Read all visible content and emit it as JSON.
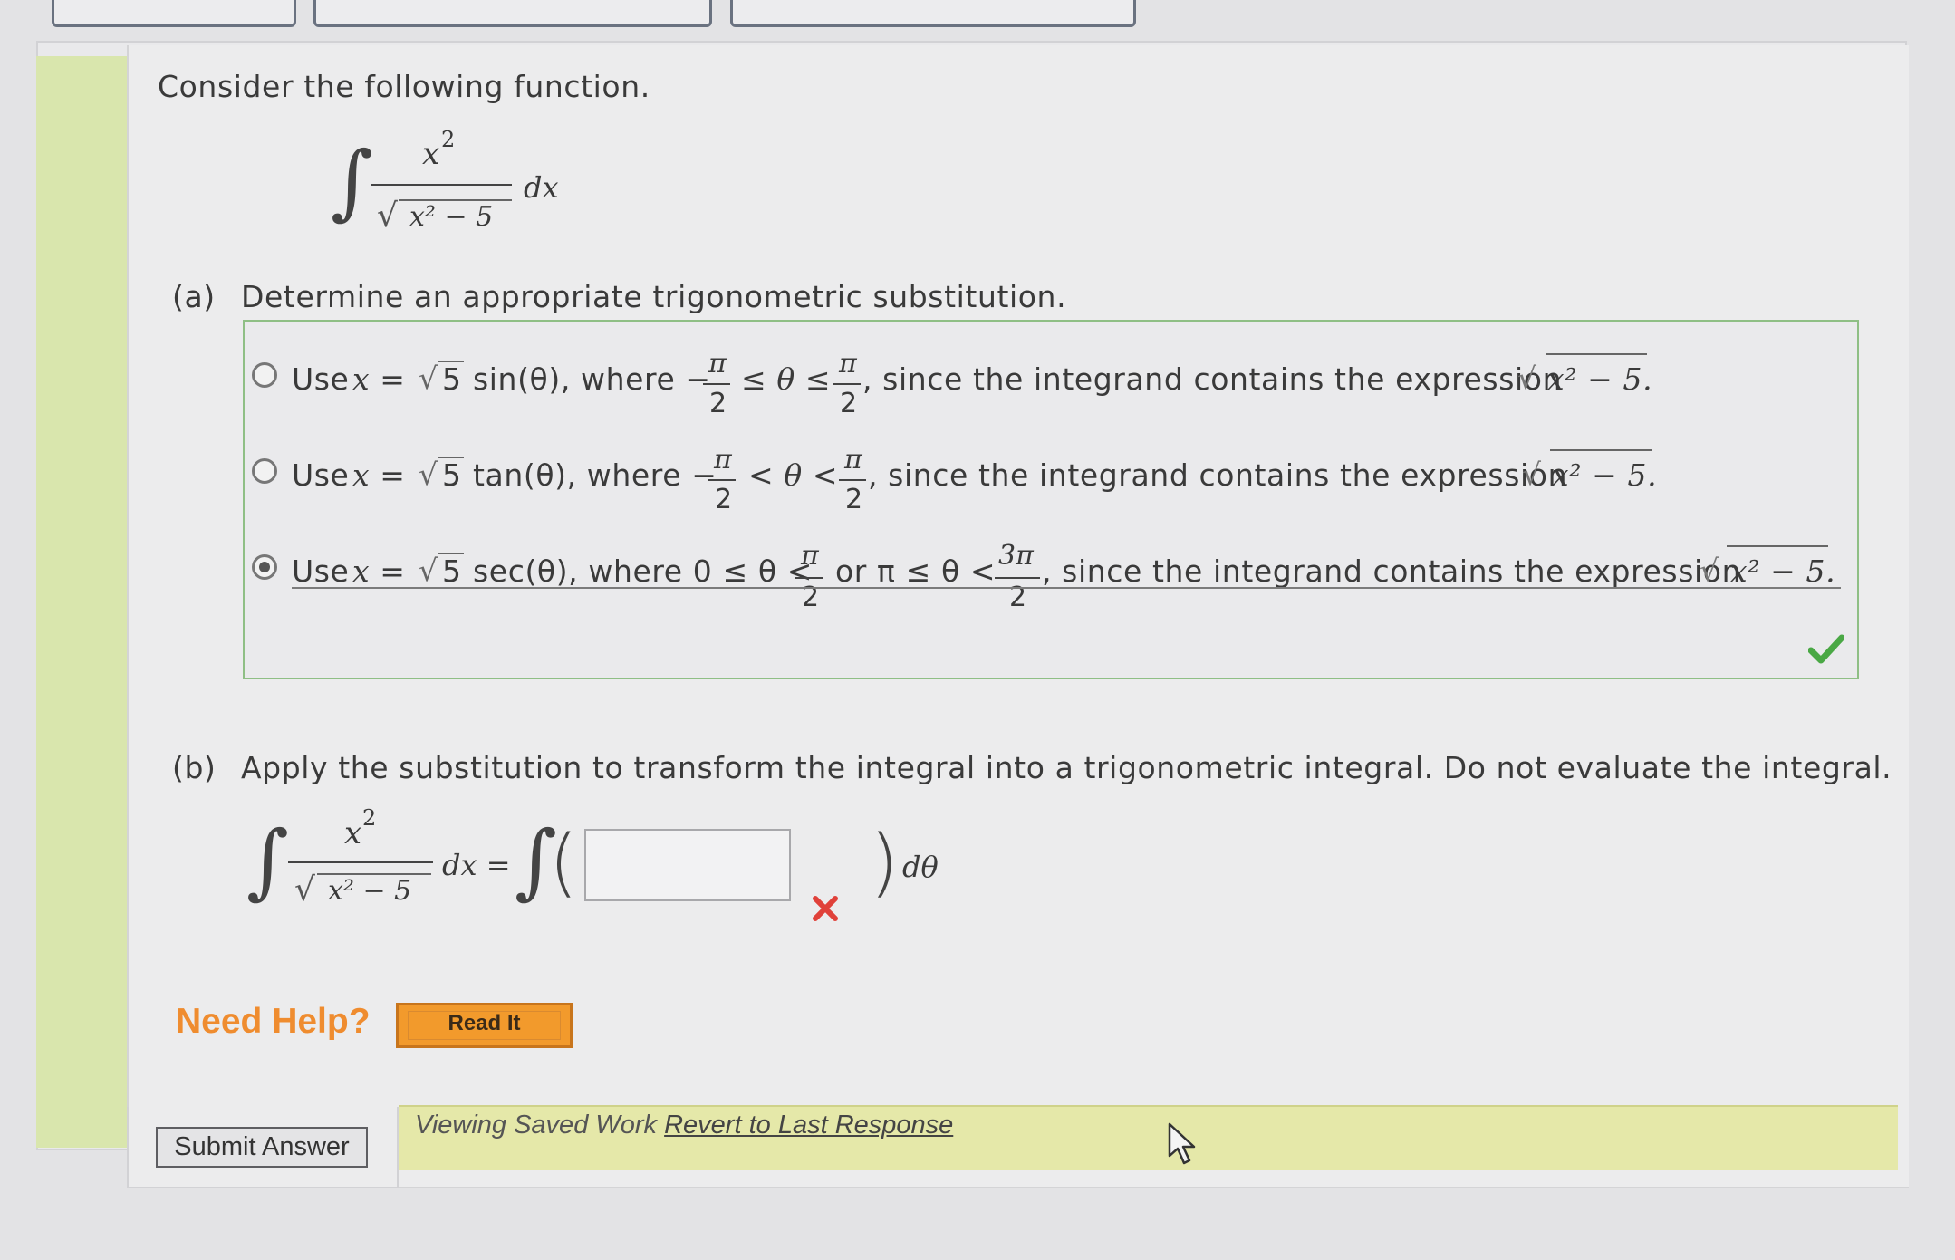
{
  "question": {
    "intro": "Consider the following function.",
    "integral": {
      "numerator_var": "x",
      "exponent": "2",
      "denominator_inner": "x² − 5",
      "differential": "dx"
    }
  },
  "part_a": {
    "label": "(a)",
    "prompt": "Determine an appropriate trigonometric substitution.",
    "options": [
      {
        "use": "Use",
        "x_eq": "x =",
        "sqrt5": "5",
        "func": "sin(θ), where −",
        "pi": "π",
        "two": "2",
        "rel1": "≤ θ ≤",
        "tail": ", since the integrand contains the expression",
        "expr": "x² − 5.",
        "selected": false
      },
      {
        "use": "Use",
        "x_eq": "x =",
        "sqrt5": "5",
        "func": "tan(θ), where −",
        "pi": "π",
        "two": "2",
        "rel1": "< θ <",
        "tail": ", since the integrand contains the expression",
        "expr": "x² − 5.",
        "selected": false
      },
      {
        "use": "Use",
        "x_eq": "x =",
        "sqrt5": "5",
        "func": "sec(θ), where 0 ≤ θ <",
        "pi": "π",
        "two": "2",
        "mid": "or π ≤ θ <",
        "pi3": "3π",
        "tail": ", since the integrand contains the expression",
        "expr": "x² − 5.",
        "selected": true
      }
    ],
    "status": "correct"
  },
  "part_b": {
    "label": "(b)",
    "prompt": "Apply the substitution to transform the integral into a trigonometric integral. Do not evaluate the integral.",
    "lhs": {
      "numerator_var": "x",
      "exponent": "2",
      "denominator_inner": "x² − 5",
      "differential": "dx ="
    },
    "input_value": "",
    "rhs_differential": "dθ",
    "status": "incorrect"
  },
  "help": {
    "label": "Need Help?",
    "read_it": "Read It"
  },
  "submit_label": "Submit Answer",
  "saved": {
    "text": "Viewing Saved Work",
    "link": "Revert to Last Response"
  },
  "colors": {
    "help_orange": "#f29a2c",
    "correct_green": "#4aa845",
    "incorrect_red": "#e0413a"
  }
}
